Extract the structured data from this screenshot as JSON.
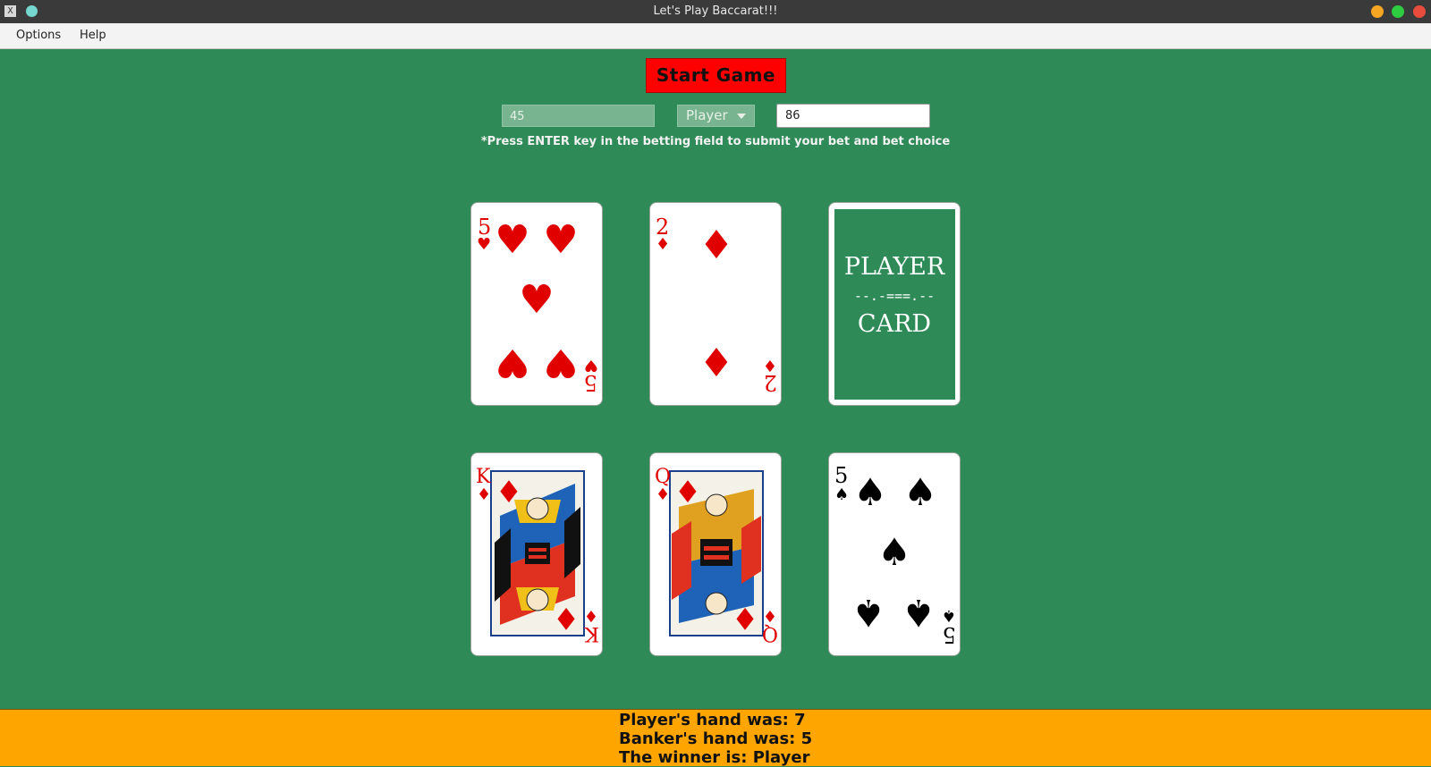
{
  "window": {
    "title": "Let's Play Baccarat!!!",
    "app_icon_glyph": "X",
    "colors": {
      "minimize": "#f5a623",
      "maximize": "#2ecc40",
      "close": "#e74c3c"
    }
  },
  "menu": {
    "options": "Options",
    "help": "Help"
  },
  "controls": {
    "start_label": "Start Game",
    "bet_field_value": "45",
    "bet_choice_value": "Player",
    "amount_field_value": "86",
    "hint": "*Press ENTER key in the betting field to submit your bet and bet choice"
  },
  "cards": {
    "player": [
      {
        "rank": "5",
        "suit": "hearts",
        "suit_glyph": "♥",
        "color": "#e00000"
      },
      {
        "rank": "2",
        "suit": "diamonds",
        "suit_glyph": "♦",
        "color": "#e00000"
      },
      {
        "face_down": true,
        "back_line1": "PLAYER",
        "back_line2": "--.-===.--",
        "back_line3": "CARD"
      }
    ],
    "banker": [
      {
        "rank": "K",
        "suit": "diamonds",
        "suit_glyph": "♦",
        "color": "#e00000"
      },
      {
        "rank": "Q",
        "suit": "diamonds",
        "suit_glyph": "♦",
        "color": "#e00000"
      },
      {
        "rank": "5",
        "suit": "spades",
        "suit_glyph": "♠",
        "color": "#000000"
      }
    ]
  },
  "results": {
    "player_hand": "Player's hand was: 7",
    "banker_hand": "Banker's hand was: 5",
    "winner": "The winner is: Player"
  }
}
